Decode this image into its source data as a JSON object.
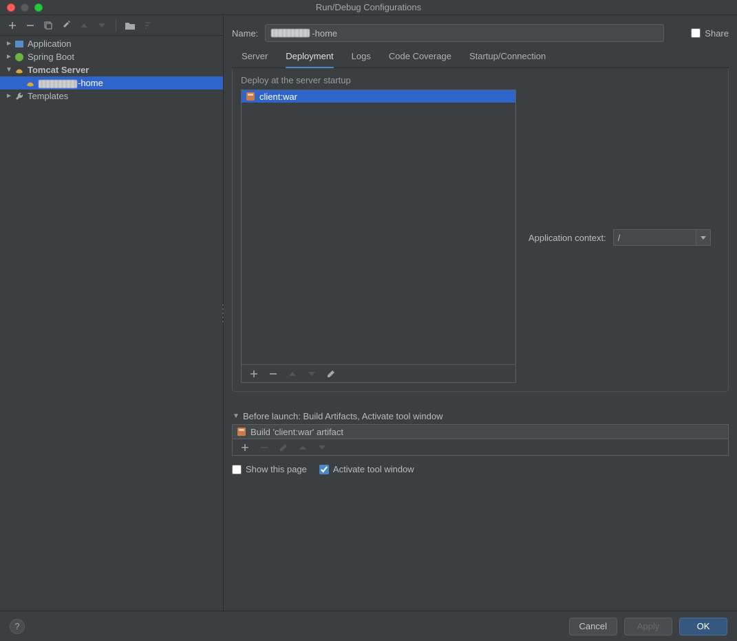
{
  "window": {
    "title": "Run/Debug Configurations"
  },
  "sidebar": {
    "items": [
      {
        "label": "Application",
        "expanded": false
      },
      {
        "label": "Spring Boot",
        "expanded": false
      },
      {
        "label": "Tomcat Server",
        "expanded": true,
        "bold": true,
        "children": [
          {
            "label": "-home",
            "selected": true
          }
        ]
      },
      {
        "label": "Templates",
        "expanded": false
      }
    ]
  },
  "form": {
    "name_label": "Name:",
    "name_value": "-home",
    "share_label": "Share",
    "share_checked": false
  },
  "tabs": {
    "items": [
      "Server",
      "Deployment",
      "Logs",
      "Code Coverage",
      "Startup/Connection"
    ],
    "active": "Deployment"
  },
  "deployment": {
    "caption": "Deploy at the server startup",
    "artifacts": [
      {
        "label": "client:war"
      }
    ],
    "context_label": "Application context:",
    "context_value": "/"
  },
  "before_launch": {
    "header": "Before launch: Build Artifacts, Activate tool window",
    "tasks": [
      {
        "label": "Build 'client:war' artifact"
      }
    ]
  },
  "checks": {
    "show_page_label": "Show this page",
    "show_page_checked": false,
    "activate_label": "Activate tool window",
    "activate_checked": true
  },
  "footer": {
    "cancel": "Cancel",
    "apply": "Apply",
    "ok": "OK"
  }
}
